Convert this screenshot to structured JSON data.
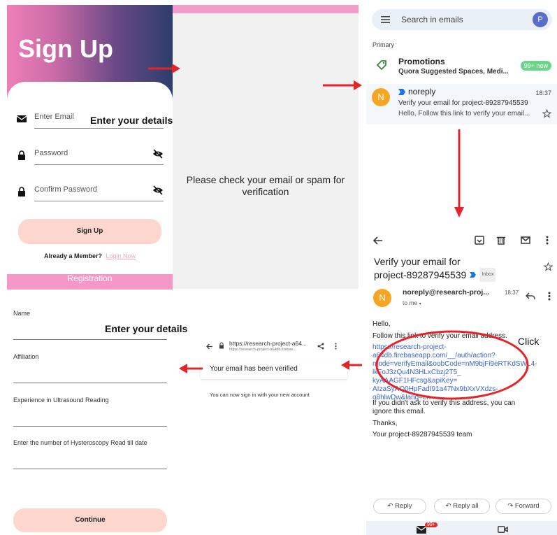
{
  "signup": {
    "title": "Sign Up",
    "email_placeholder": "Enter Email",
    "password_placeholder": "Password",
    "confirm_password_placeholder": "Confirm Password",
    "signup_button": "Sign Up",
    "member_text": "Already a Member?",
    "login_link": "Login Now",
    "overlay_label": "Enter your details"
  },
  "check_email": {
    "message": "Please check your email or spam for verification"
  },
  "inbox": {
    "search_placeholder": "Search in emails",
    "avatar_letter": "P",
    "section": "Primary",
    "promotions": {
      "title": "Promotions",
      "subtitle": "Quora Suggested Spaces, Medi...",
      "badge": "99+ new"
    },
    "message": {
      "avatar_letter": "N",
      "sender": "noreply",
      "time": "18:37",
      "subject": "Verify your email for project-89287945539",
      "preview": "Hello, Follow this link to verify your email..."
    }
  },
  "email_detail": {
    "subject_line1": "Verify your email for",
    "subject_line2": "project-89287945539",
    "inbox_tag": "Inbox",
    "avatar_letter": "N",
    "sender": "noreply@research-proj...",
    "time": "18:37",
    "to": "to me",
    "greeting": "Hello,",
    "instruction": "Follow this link to verify your email address.",
    "link_lines": [
      "https://research-project-",
      "a64db.firebaseapp.com/__/auth/action?",
      "mode=verifyEmail&oobCode=nM9bjFi9eRTKdSWL4-",
      "lkFoJ3zQu4N3HLxCbzj2T5_",
      "kyAAAGF1HFcsg&apiKey=",
      "AIzaSyAQ0HpFadI91a47Nx9bXxVXdzs-",
      "o8hlwDw&lang=en"
    ],
    "ignore_line1": "If you didn't ask to verify this address, you can",
    "ignore_line2": "ignore this email.",
    "thanks": "Thanks,",
    "signature": "Your project-89287945539 team",
    "click_label": "Click",
    "reply": "Reply",
    "reply_all": "Reply all",
    "forward": "Forward",
    "nav_badge": "99+"
  },
  "browser": {
    "url": "https://research-project-a64...",
    "url_sub": "https://research-project-a64db.firebas...",
    "verified_title": "Your email has been verified",
    "verified_body": "You can now sign in with your new account"
  },
  "registration": {
    "bar_title": "Registration",
    "name_label": "Name",
    "affiliation_label": "Affiliation",
    "experience_label": "Experience in Ultrasound Reading",
    "hysteroscopy_label": "Enter the number of Hysteroscopy Read till date",
    "continue_button": "Continue",
    "overlay_label": "Enter your details"
  },
  "colors": {
    "arrow": "#e5242a",
    "pink": "#f597c7",
    "peach": "#fdd7cd",
    "link_blue": "#3b64c9"
  }
}
